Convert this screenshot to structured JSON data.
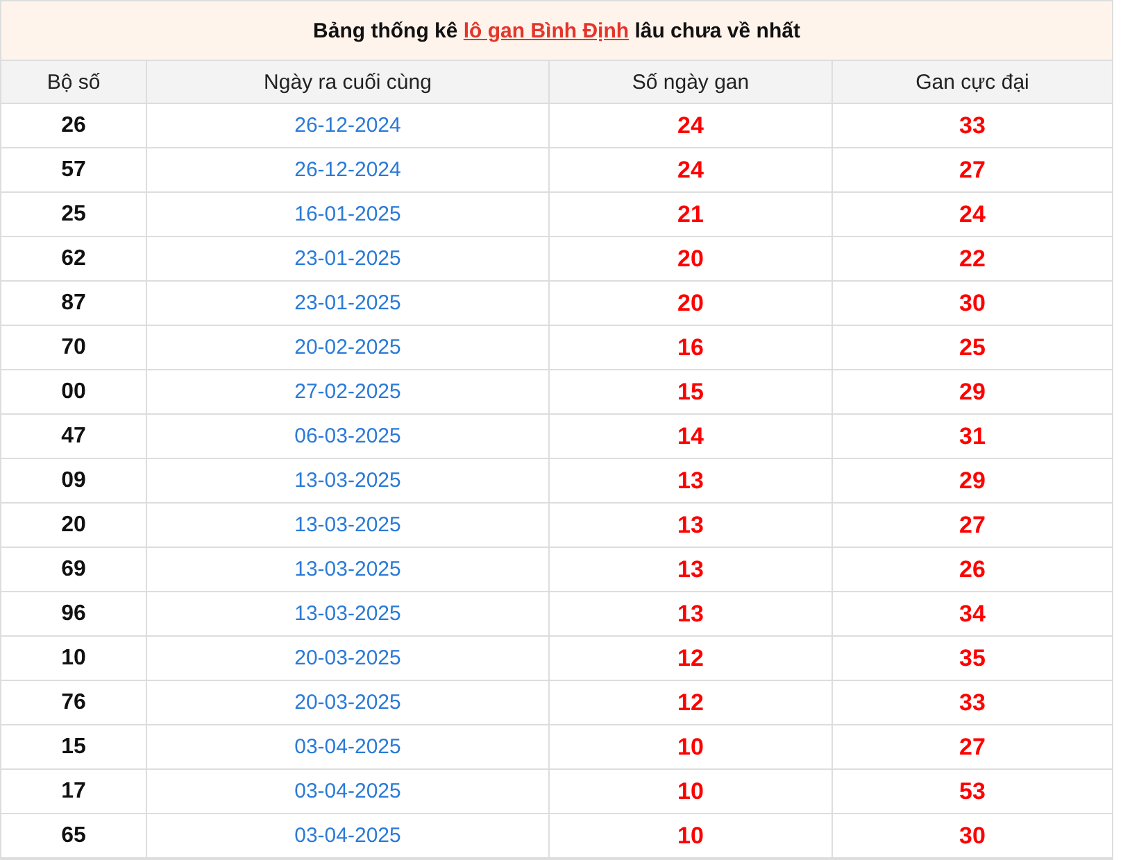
{
  "title": {
    "before": "Bảng thống kê",
    "link": "lô gan Bình Định",
    "after": "lâu chưa về nhất"
  },
  "table": {
    "columns": [
      "Bộ số",
      "Ngày ra cuối cùng",
      "Số ngày gan",
      "Gan cực đại"
    ],
    "rows": [
      [
        "26",
        "26-12-2024",
        "24",
        "33"
      ],
      [
        "57",
        "26-12-2024",
        "24",
        "27"
      ],
      [
        "25",
        "16-01-2025",
        "21",
        "24"
      ],
      [
        "62",
        "23-01-2025",
        "20",
        "22"
      ],
      [
        "87",
        "23-01-2025",
        "20",
        "30"
      ],
      [
        "70",
        "20-02-2025",
        "16",
        "25"
      ],
      [
        "00",
        "27-02-2025",
        "15",
        "29"
      ],
      [
        "47",
        "06-03-2025",
        "14",
        "31"
      ],
      [
        "09",
        "13-03-2025",
        "13",
        "29"
      ],
      [
        "20",
        "13-03-2025",
        "13",
        "27"
      ],
      [
        "69",
        "13-03-2025",
        "13",
        "26"
      ],
      [
        "96",
        "13-03-2025",
        "13",
        "34"
      ],
      [
        "10",
        "20-03-2025",
        "12",
        "35"
      ],
      [
        "76",
        "20-03-2025",
        "12",
        "33"
      ],
      [
        "15",
        "03-04-2025",
        "10",
        "27"
      ],
      [
        "17",
        "03-04-2025",
        "10",
        "53"
      ],
      [
        "65",
        "03-04-2025",
        "10",
        "30"
      ]
    ]
  }
}
